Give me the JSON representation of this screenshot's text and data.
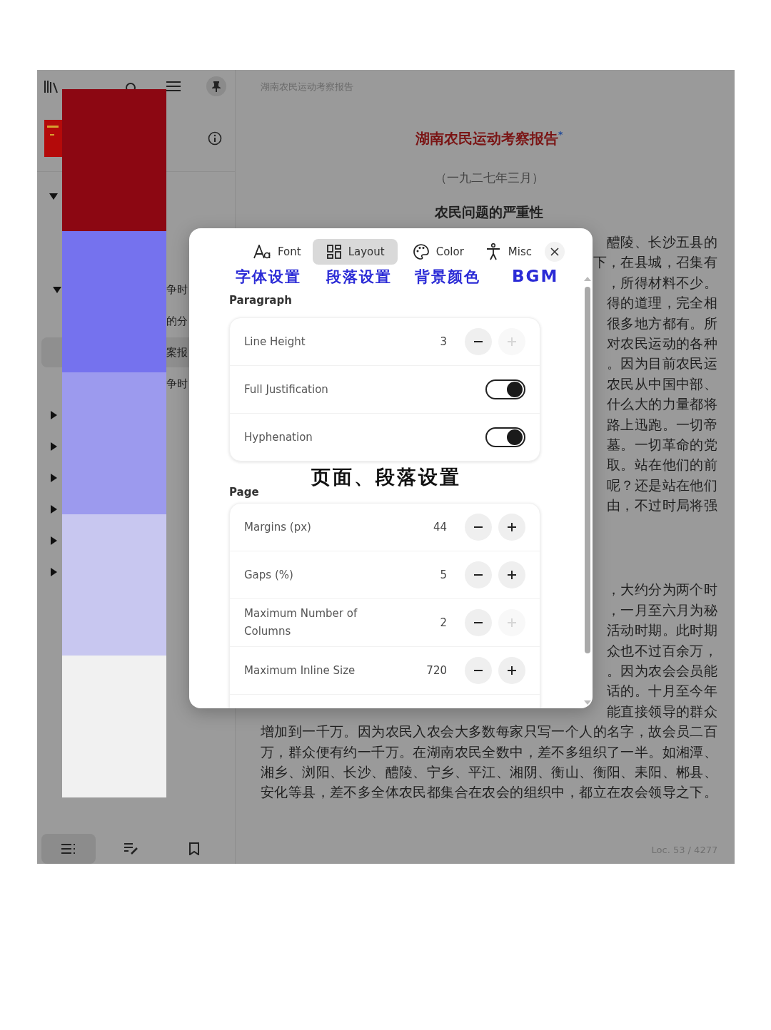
{
  "sidebar": {
    "toc": [
      {
        "expanded": true,
        "selected": false,
        "children": [
          {
            "text": "争时",
            "expanded": true,
            "selected": false,
            "children": [
              {
                "text": "的分",
                "selected": false
              },
              {
                "text": "案报",
                "selected": true
              }
            ]
          },
          {
            "text": "争时",
            "selected": false
          }
        ]
      },
      {
        "expanded": false,
        "selected": false
      },
      {
        "expanded": false,
        "selected": false
      },
      {
        "expanded": false,
        "selected": false
      },
      {
        "expanded": false,
        "selected": false
      },
      {
        "expanded": false,
        "selected": false
      },
      {
        "expanded": false,
        "selected": false
      }
    ],
    "bottom_tabs": [
      {
        "kind": "contents",
        "selected": true
      },
      {
        "kind": "notes",
        "selected": false
      },
      {
        "kind": "bookmarks",
        "selected": false
      }
    ]
  },
  "palette_swatches": [
    {
      "color": "#8c0712"
    },
    {
      "color": "#7572ee"
    },
    {
      "color": "#9c9aee"
    },
    {
      "color": "#c8c7f0"
    },
    {
      "color": "#f1f1f1"
    }
  ],
  "reader": {
    "header": "湖南农民运动考察报告",
    "title": "湖南农民运动考察报告$^{*}$",
    "subtitle": "（一九二七年三月）",
    "heading": "农民问题的严重性",
    "paragraphs": [
      [
        "醴陵、长沙五县的",
        "下，在县城，召集有",
        "，所得材料不少。",
        "得的道理，完全相",
        "很多地方都有。所",
        "对农民运动的各种",
        "。因为目前农民运",
        "农民从中国中部、",
        "什么大的力量都将",
        "路上迅跑。一切帝",
        "墓。一切革命的党",
        "取。站在他们的前",
        "呢？还是站在他们",
        "由，不过时局将强"
      ],
      [
        "，大约分为两个时",
        "，一月至六月为秘",
        "活动时期。此时期",
        "众也不过百余万，",
        "。因为农会会员能",
        "话的。十月至今年",
        "能直接领导的群众",
        "增加到一千万。因为农民入农会大多数每家只写一个人的名字，故会员二百",
        "万，群众便有约一千万。在湖南农民全数中，差不多组织了一半。如湘潭、",
        "湘乡、浏阳、长沙、醴陵、宁乡、平江、湘阴、衡山、衡阳、耒阳、郴县、",
        "安化等县，差不多全体农民都集合在农会的组织中，都立在农会领导之下。"
      ]
    ],
    "location": "Loc. 53 / 4277"
  },
  "settings_panel": {
    "tabs": [
      {
        "kind": "font",
        "label": "Font",
        "selected": false,
        "annotation": "字体设置"
      },
      {
        "kind": "layout",
        "label": "Layout",
        "selected": true,
        "annotation": "段落设置"
      },
      {
        "kind": "color",
        "label": "Color",
        "selected": false,
        "annotation": "背景颜色"
      },
      {
        "kind": "misc",
        "label": "Misc",
        "selected": false,
        "annotation": "BGM"
      }
    ],
    "sections": [
      {
        "title": "Paragraph",
        "rows": [
          {
            "kind": "stepper",
            "label": "Line Height",
            "value": "3",
            "decrease_disabled": false,
            "increase_disabled": true
          },
          {
            "kind": "toggle",
            "label": "Full Justification",
            "on": true
          },
          {
            "kind": "toggle",
            "label": "Hyphenation",
            "on": true
          }
        ]
      },
      {
        "title": "Page",
        "annotation": "页面、段落设置",
        "rows": [
          {
            "kind": "stepper",
            "label": "Margins (px)",
            "value": "44",
            "decrease_disabled": false,
            "increase_disabled": false
          },
          {
            "kind": "stepper",
            "label": "Gaps (%)",
            "value": "5",
            "decrease_disabled": false,
            "increase_disabled": false
          },
          {
            "kind": "stepper",
            "label": "Maximum Number of Columns",
            "value": "2",
            "decrease_disabled": false,
            "increase_disabled": true
          },
          {
            "kind": "stepper",
            "label": "Maximum Inline Size",
            "value": "720",
            "decrease_disabled": false,
            "increase_disabled": false
          }
        ]
      }
    ]
  }
}
